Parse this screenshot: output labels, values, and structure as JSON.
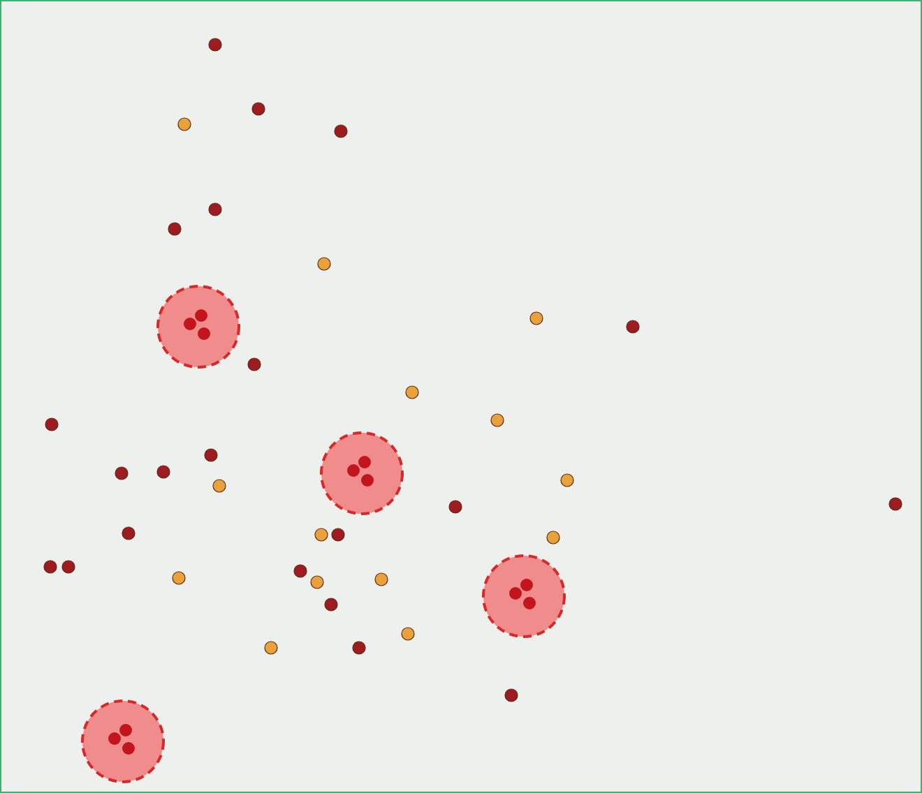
{
  "map": {
    "markers": [
      {
        "kind": "cluster",
        "color": "#f08c8c"
      },
      {
        "kind": "cluster",
        "color": "#f08c8c"
      },
      {
        "kind": "cluster",
        "color": "#f08c8c"
      },
      {
        "kind": "cluster",
        "color": "#f08c8c"
      },
      {
        "kind": "point",
        "color": "#9e1b22"
      },
      {
        "kind": "point",
        "color": "#9e1b22"
      },
      {
        "kind": "point",
        "color": "#9e1b22"
      },
      {
        "kind": "point",
        "color": "#9e1b22"
      },
      {
        "kind": "point",
        "color": "#9e1b22"
      },
      {
        "kind": "point",
        "color": "#9e1b22"
      },
      {
        "kind": "point",
        "color": "#9e1b22"
      },
      {
        "kind": "point",
        "color": "#9e1b22"
      },
      {
        "kind": "point",
        "color": "#9e1b22"
      },
      {
        "kind": "point",
        "color": "#9e1b22"
      },
      {
        "kind": "point",
        "color": "#9e1b22"
      },
      {
        "kind": "point",
        "color": "#9e1b22"
      },
      {
        "kind": "point",
        "color": "#9e1b22"
      },
      {
        "kind": "point",
        "color": "#9e1b22"
      },
      {
        "kind": "point",
        "color": "#9e1b22"
      },
      {
        "kind": "point",
        "color": "#9e1b22"
      },
      {
        "kind": "point",
        "color": "#9e1b22"
      },
      {
        "kind": "point",
        "color": "#9e1b22"
      },
      {
        "kind": "point",
        "color": "#9e1b22"
      },
      {
        "kind": "point",
        "color": "#9e1b22"
      },
      {
        "kind": "point",
        "color": "#9e1b22"
      },
      {
        "kind": "point",
        "color": "#e9a23b"
      },
      {
        "kind": "point",
        "color": "#e9a23b"
      },
      {
        "kind": "point",
        "color": "#e9a23b"
      },
      {
        "kind": "point",
        "color": "#e9a23b"
      },
      {
        "kind": "point",
        "color": "#e9a23b"
      },
      {
        "kind": "point",
        "color": "#e9a23b"
      },
      {
        "kind": "point",
        "color": "#e9a23b"
      },
      {
        "kind": "point",
        "color": "#e9a23b"
      },
      {
        "kind": "point",
        "color": "#e9a23b"
      },
      {
        "kind": "point",
        "color": "#e9a23b"
      },
      {
        "kind": "point",
        "color": "#e9a23b"
      },
      {
        "kind": "point",
        "color": "#e9a23b"
      },
      {
        "kind": "point",
        "color": "#e9a23b"
      },
      {
        "kind": "point",
        "color": "#e9a23b"
      }
    ]
  }
}
